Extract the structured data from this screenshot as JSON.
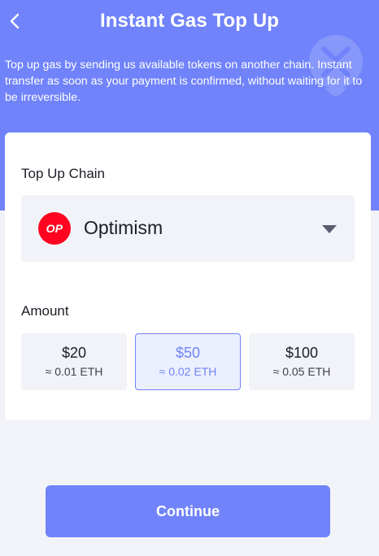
{
  "header": {
    "title": "Instant Gas Top Up",
    "back_icon": "chevron-left-icon",
    "watermark_icon": "wallet-logo-icon",
    "description": "Top up gas by sending us available tokens on another chain. Instant transfer as soon as your payment is confirmed, without waiting for it to be irreversible."
  },
  "chain_section": {
    "label": "Top Up Chain",
    "selected_chain": {
      "name": "Optimism",
      "logo_text": "OP",
      "logo_color": "#ff0420"
    },
    "dropdown_icon": "caret-down-icon"
  },
  "amount_section": {
    "label": "Amount",
    "options": [
      {
        "price": "$20",
        "eth": "≈ 0.01 ETH",
        "selected": false
      },
      {
        "price": "$50",
        "eth": "≈ 0.02 ETH",
        "selected": true
      },
      {
        "price": "$100",
        "eth": "≈ 0.05 ETH",
        "selected": false
      }
    ]
  },
  "footer": {
    "continue_label": "Continue"
  },
  "colors": {
    "accent": "#7083fa",
    "background": "#f2f3f8",
    "card": "#ffffff",
    "text": "#1b1c26"
  }
}
